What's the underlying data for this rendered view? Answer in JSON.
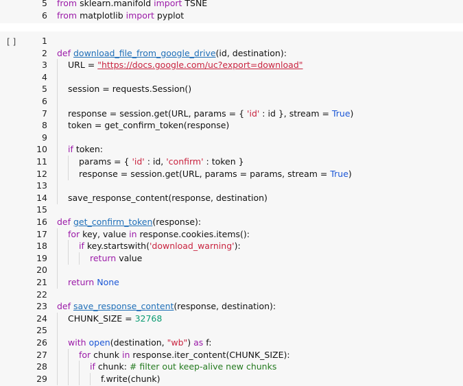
{
  "previous_cell": {
    "lines": [
      {
        "n": "5",
        "parts": [
          [
            "kw",
            "from"
          ],
          [
            "nm",
            " sklearn.manifold "
          ],
          [
            "kw",
            "import"
          ],
          [
            "nm",
            " TSNE"
          ]
        ]
      },
      {
        "n": "6",
        "parts": [
          [
            "kw",
            "from"
          ],
          [
            "nm",
            " matplotlib "
          ],
          [
            "kw",
            "import"
          ],
          [
            "nm",
            " pyplot"
          ]
        ]
      }
    ]
  },
  "cell": {
    "run_label": "[ ]",
    "lines": [
      {
        "n": "1",
        "indent": 0,
        "parts": []
      },
      {
        "n": "2",
        "indent": 0,
        "parts": [
          [
            "kw",
            "def "
          ],
          [
            "fn",
            "download_file_from_google_drive"
          ],
          [
            "nm",
            "(id, destination):"
          ]
        ]
      },
      {
        "n": "3",
        "indent": 1,
        "parts": [
          [
            "nm",
            "URL = "
          ],
          [
            "url",
            "\"https://docs.google.com/uc?export=download\""
          ]
        ]
      },
      {
        "n": "4",
        "indent": 1,
        "parts": []
      },
      {
        "n": "5",
        "indent": 1,
        "parts": [
          [
            "nm",
            "session = requests.Session()"
          ]
        ]
      },
      {
        "n": "6",
        "indent": 1,
        "parts": []
      },
      {
        "n": "7",
        "indent": 1,
        "parts": [
          [
            "nm",
            "response = session.get(URL, params = { "
          ],
          [
            "str",
            "'id'"
          ],
          [
            "nm",
            " : id }, stream = "
          ],
          [
            "bi",
            "True"
          ],
          [
            "nm",
            ")"
          ]
        ]
      },
      {
        "n": "8",
        "indent": 1,
        "parts": [
          [
            "nm",
            "token = get_confirm_token(response)"
          ]
        ]
      },
      {
        "n": "9",
        "indent": 1,
        "parts": []
      },
      {
        "n": "10",
        "indent": 1,
        "parts": [
          [
            "kw",
            "if"
          ],
          [
            "nm",
            " token:"
          ]
        ]
      },
      {
        "n": "11",
        "indent": 2,
        "parts": [
          [
            "nm",
            "params = { "
          ],
          [
            "str",
            "'id'"
          ],
          [
            "nm",
            " : id, "
          ],
          [
            "str",
            "'confirm'"
          ],
          [
            "nm",
            " : token }"
          ]
        ]
      },
      {
        "n": "12",
        "indent": 2,
        "parts": [
          [
            "nm",
            "response = session.get(URL, params = params, stream = "
          ],
          [
            "bi",
            "True"
          ],
          [
            "nm",
            ")"
          ]
        ]
      },
      {
        "n": "13",
        "indent": 1,
        "parts": []
      },
      {
        "n": "14",
        "indent": 1,
        "parts": [
          [
            "nm",
            "save_response_content(response, destination)"
          ]
        ]
      },
      {
        "n": "15",
        "indent": 0,
        "parts": []
      },
      {
        "n": "16",
        "indent": 0,
        "parts": [
          [
            "kw",
            "def "
          ],
          [
            "fn",
            "get_confirm_token"
          ],
          [
            "nm",
            "(response):"
          ]
        ]
      },
      {
        "n": "17",
        "indent": 1,
        "parts": [
          [
            "kw",
            "for"
          ],
          [
            "nm",
            " key, value "
          ],
          [
            "kw",
            "in"
          ],
          [
            "nm",
            " response.cookies.items():"
          ]
        ]
      },
      {
        "n": "18",
        "indent": 2,
        "parts": [
          [
            "kw",
            "if"
          ],
          [
            "nm",
            " key.startswith("
          ],
          [
            "str",
            "'download_warning'"
          ],
          [
            "nm",
            "):"
          ]
        ]
      },
      {
        "n": "19",
        "indent": 3,
        "parts": [
          [
            "kw",
            "return"
          ],
          [
            "nm",
            " value"
          ]
        ]
      },
      {
        "n": "20",
        "indent": 1,
        "parts": []
      },
      {
        "n": "21",
        "indent": 1,
        "parts": [
          [
            "kw",
            "return"
          ],
          [
            "nm",
            " "
          ],
          [
            "bi",
            "None"
          ]
        ]
      },
      {
        "n": "22",
        "indent": 0,
        "parts": []
      },
      {
        "n": "23",
        "indent": 0,
        "parts": [
          [
            "kw",
            "def "
          ],
          [
            "fn",
            "save_response_content"
          ],
          [
            "nm",
            "(response, destination):"
          ]
        ]
      },
      {
        "n": "24",
        "indent": 1,
        "parts": [
          [
            "nm",
            "CHUNK_SIZE = "
          ],
          [
            "num",
            "32768"
          ]
        ]
      },
      {
        "n": "25",
        "indent": 1,
        "parts": []
      },
      {
        "n": "26",
        "indent": 1,
        "parts": [
          [
            "kw",
            "with"
          ],
          [
            "nm",
            " "
          ],
          [
            "bi",
            "open"
          ],
          [
            "nm",
            "(destination, "
          ],
          [
            "str",
            "\"wb\""
          ],
          [
            "nm",
            ") "
          ],
          [
            "kw",
            "as"
          ],
          [
            "nm",
            " f:"
          ]
        ]
      },
      {
        "n": "27",
        "indent": 2,
        "parts": [
          [
            "kw",
            "for"
          ],
          [
            "nm",
            " chunk "
          ],
          [
            "kw",
            "in"
          ],
          [
            "nm",
            " response.iter_content(CHUNK_SIZE):"
          ]
        ]
      },
      {
        "n": "28",
        "indent": 3,
        "parts": [
          [
            "kw",
            "if"
          ],
          [
            "nm",
            " chunk: "
          ],
          [
            "cm",
            "# filter out keep-alive new chunks"
          ]
        ]
      },
      {
        "n": "29",
        "indent": 4,
        "parts": [
          [
            "nm",
            "f.write(chunk)"
          ]
        ]
      }
    ]
  }
}
